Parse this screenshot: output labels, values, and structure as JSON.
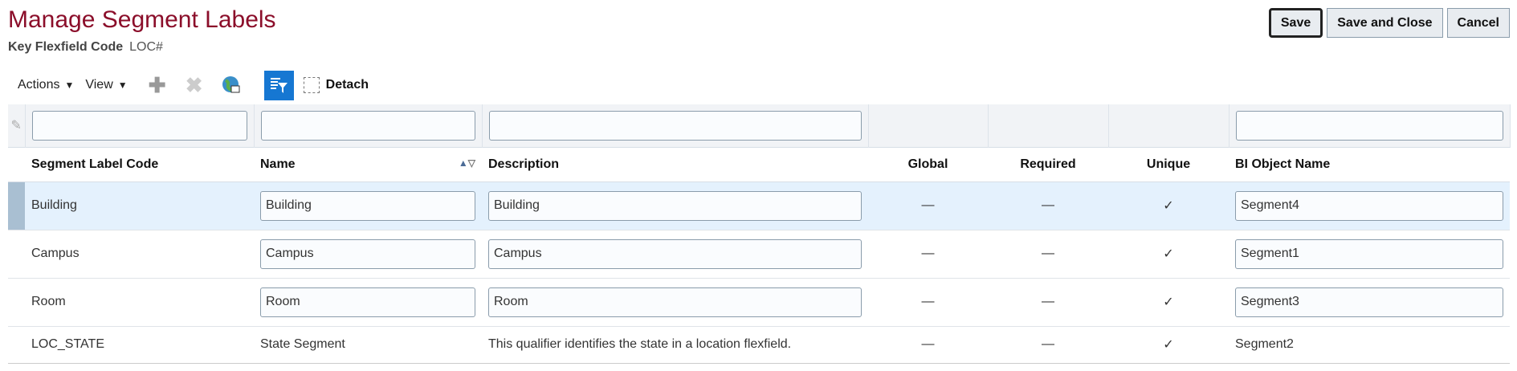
{
  "header": {
    "title": "Manage Segment Labels",
    "subtitle_label": "Key Flexfield Code",
    "subtitle_value": "LOC#"
  },
  "buttons": {
    "save": "Save",
    "save_close": "Save and Close",
    "cancel": "Cancel"
  },
  "toolbar": {
    "actions": "Actions",
    "view": "View",
    "detach": "Detach"
  },
  "columns": [
    "Segment Label Code",
    "Name",
    "Description",
    "Global",
    "Required",
    "Unique",
    "BI Object Name"
  ],
  "rows": [
    {
      "code": "Building",
      "name": "Building",
      "description": "Building",
      "global": "—",
      "required": "—",
      "unique": "✓",
      "bi": "Segment4"
    },
    {
      "code": "Campus",
      "name": "Campus",
      "description": "Campus",
      "global": "—",
      "required": "—",
      "unique": "✓",
      "bi": "Segment1"
    },
    {
      "code": "Room",
      "name": "Room",
      "description": "Room",
      "global": "—",
      "required": "—",
      "unique": "✓",
      "bi": "Segment3"
    },
    {
      "code": "LOC_STATE",
      "name": "State Segment",
      "description": "This qualifier identifies the state in a location flexfield.",
      "global": "—",
      "required": "—",
      "unique": "✓",
      "bi": "Segment2"
    }
  ]
}
